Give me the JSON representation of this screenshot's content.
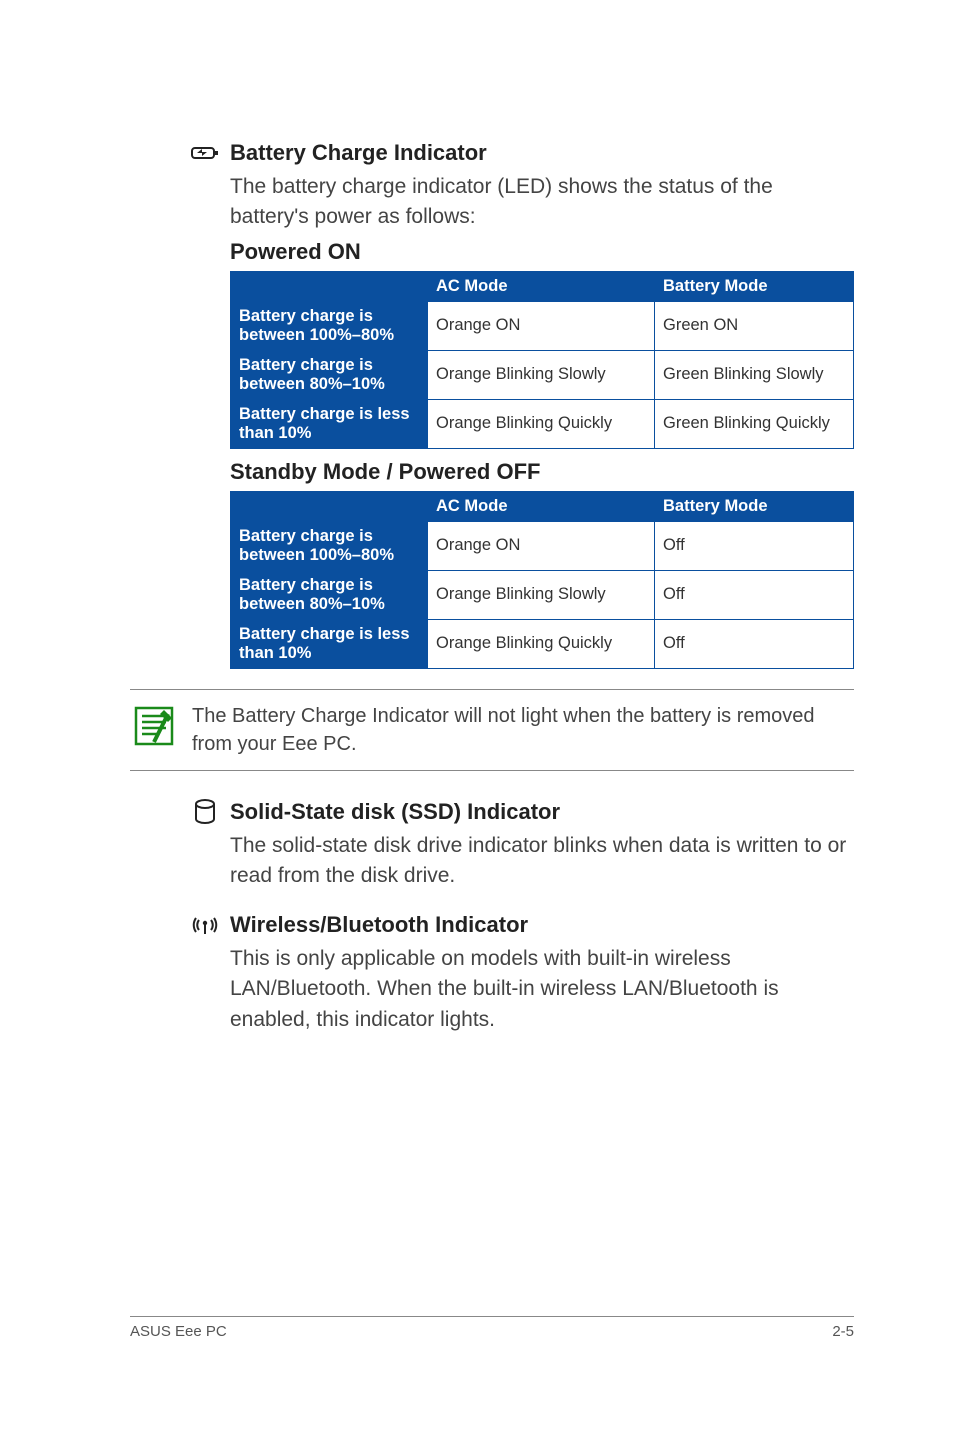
{
  "sections": {
    "battery": {
      "title": "Battery Charge Indicator",
      "body": "The battery charge indicator (LED) shows the status of the battery's power as follows:",
      "poweredOnTitle": "Powered ON",
      "standbyTitle": "Standby Mode / Powered OFF"
    },
    "ssd": {
      "title": "Solid-State disk (SSD) Indicator",
      "body": "The solid-state disk drive indicator blinks when data is written to or read from the disk drive."
    },
    "wireless": {
      "title": "Wireless/Bluetooth Indicator",
      "body": "This is only applicable on models with built-in wireless LAN/Bluetooth. When the built-in wireless LAN/Bluetooth is enabled, this indicator lights."
    }
  },
  "tables": {
    "headers": {
      "ac": "AC Mode",
      "batt": "Battery Mode"
    },
    "rowLabels": {
      "r1": "Battery charge is between 100%–80%",
      "r2": "Battery charge is between 80%–10%",
      "r3": "Battery charge is less than 10%"
    },
    "poweredOn": {
      "r1ac": "Orange ON",
      "r1b": "Green ON",
      "r2ac": "Orange Blinking Slowly",
      "r2b": "Green Blinking Slowly",
      "r3ac": "Orange Blinking Quickly",
      "r3b": "Green Blinking Quickly"
    },
    "standby": {
      "r1ac": "Orange ON",
      "r1b": "Off",
      "r2ac": "Orange Blinking Slowly",
      "r2b": "Off",
      "r3ac": "Orange Blinking Quickly",
      "r3b": "Off"
    }
  },
  "note": "The Battery Charge Indicator will not light when the battery is removed from your Eee PC.",
  "footer": {
    "left": "ASUS Eee PC",
    "right": "2-5"
  }
}
